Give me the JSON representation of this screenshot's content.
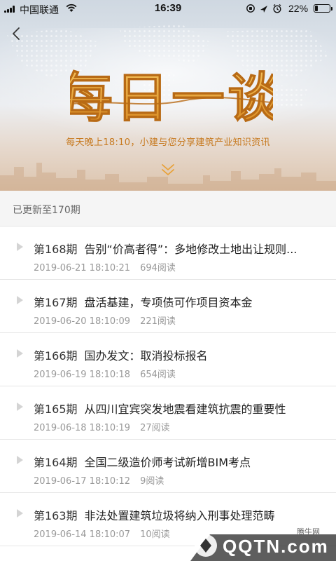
{
  "status_bar": {
    "carrier": "中国联通",
    "time": "16:39",
    "battery": "22%",
    "battery_level": 0.22
  },
  "header": {
    "title": "每日一谈",
    "subtitle": "每天晚上18:10，小建与您分享建筑产业知识资讯",
    "accent_color": "#e8a23a"
  },
  "update_status": "已更新至170期",
  "episodes": [
    {
      "number": "第168期",
      "title": "告别“价高者得”：多地修改土地出让规则...",
      "datetime": "2019-06-21 18:10:21",
      "views": "694阅读"
    },
    {
      "number": "第167期",
      "title": "盘活基建，专项债可作项目资本金",
      "datetime": "2019-06-20 18:10:09",
      "views": "221阅读"
    },
    {
      "number": "第166期",
      "title": "国办发文：取消投标报名",
      "datetime": "2019-06-19 18:10:18",
      "views": "654阅读"
    },
    {
      "number": "第165期",
      "title": "从四川宜宾突发地震看建筑抗震的重要性",
      "datetime": "2019-06-18 18:10:19",
      "views": "27阅读"
    },
    {
      "number": "第164期",
      "title": "全国二级造价师考试新增BIM考点",
      "datetime": "2019-06-17 18:10:12",
      "views": "9阅读"
    },
    {
      "number": "第163期",
      "title": "非法处置建筑垃圾将纳入刑事处理范畴",
      "datetime": "2019-06-14 18:10:07",
      "views": "10阅读"
    }
  ],
  "watermark": {
    "brand": "腾牛网",
    "logo": "QQTN.com"
  }
}
